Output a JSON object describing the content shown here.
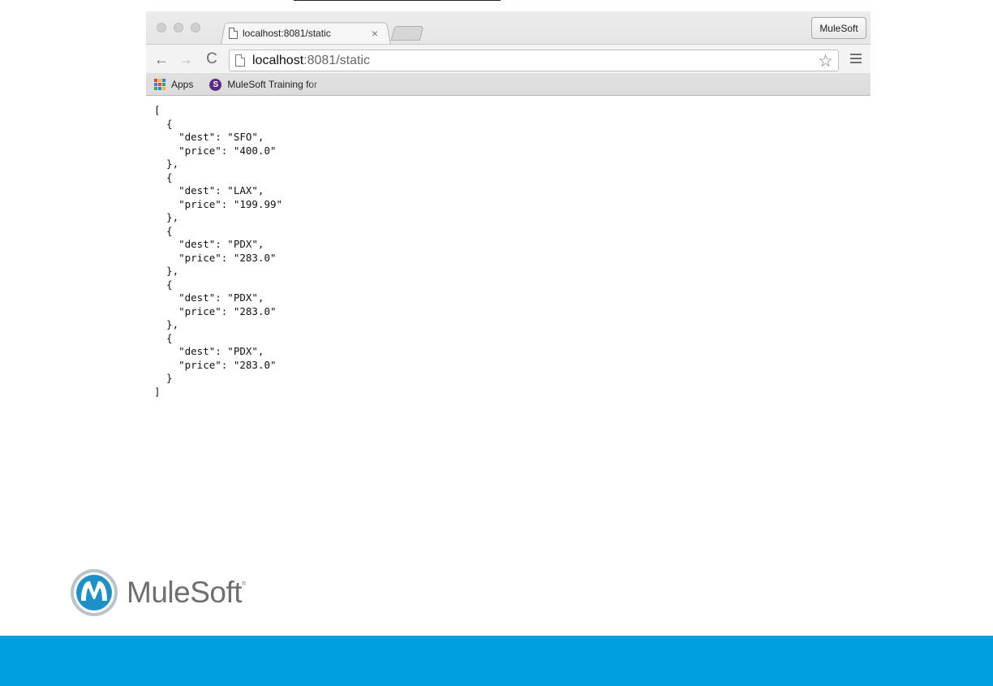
{
  "browser": {
    "tab": {
      "title": "localhost:8081/static",
      "close_glyph": "×"
    },
    "profile_button": "MuleSoft",
    "toolbar": {
      "back_glyph": "←",
      "forward_glyph": "→",
      "reload_glyph": "C",
      "url_host": "localhost",
      "url_path": ":8081/static",
      "star_glyph": "☆"
    },
    "bookmarks": [
      {
        "label": "Apps",
        "icon": "apps-grid-icon"
      },
      {
        "label": "MuleSoft Training for",
        "icon": "mulesoft-favicon-icon"
      }
    ]
  },
  "response_json": "[\n  {\n    \"dest\": \"SFO\",\n    \"price\": \"400.0\"\n  },\n  {\n    \"dest\": \"LAX\",\n    \"price\": \"199.99\"\n  },\n  {\n    \"dest\": \"PDX\",\n    \"price\": \"283.0\"\n  },\n  {\n    \"dest\": \"PDX\",\n    \"price\": \"283.0\"\n  },\n  {\n    \"dest\": \"PDX\",\n    \"price\": \"283.0\"\n  }\n]",
  "branding": {
    "logo_text": "MuleSoft",
    "trademark": "®"
  },
  "colors": {
    "footer_bar": "#00a0df",
    "logo_blue": "#1e90c8",
    "logo_gray": "#6f6f6f"
  }
}
